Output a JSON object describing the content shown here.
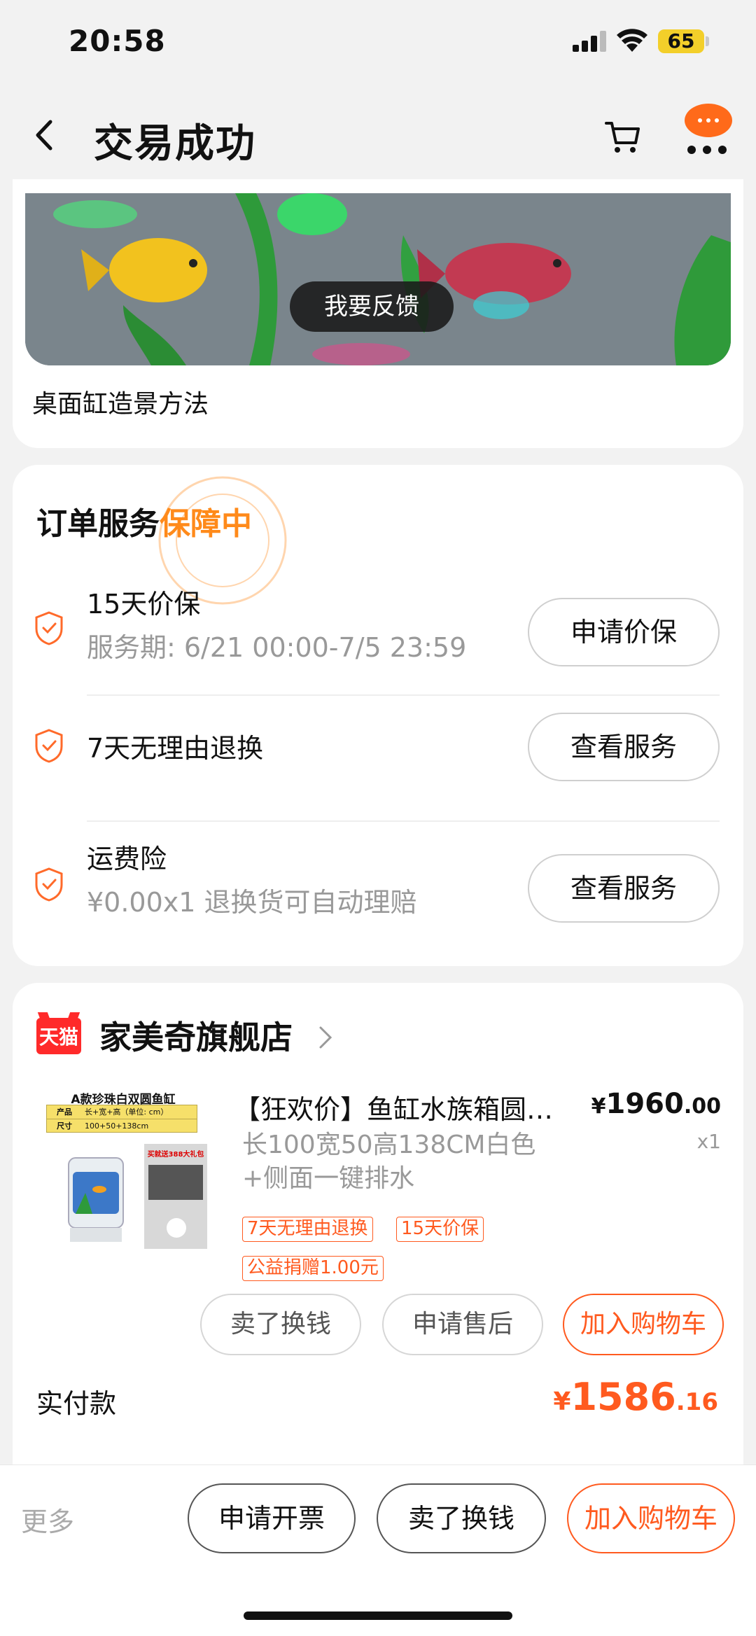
{
  "status_bar": {
    "time": "20:58",
    "battery": "65"
  },
  "nav": {
    "title": "交易成功"
  },
  "video": {
    "feedback_label": "我要反馈",
    "caption": "桌面缸造景方法"
  },
  "service": {
    "title": "订单服务",
    "status": "保障中",
    "items": [
      {
        "name": "15天价保",
        "sub": "服务期: 6/21 00:00-7/5 23:59",
        "button": "申请价保"
      },
      {
        "name": "7天无理由退换",
        "sub": "",
        "button": "查看服务"
      },
      {
        "name": "运费险",
        "sub": "¥0.00x1  退换货可自动理赔",
        "button": "查看服务"
      }
    ]
  },
  "shop": {
    "badge": "天猫",
    "name": "家美奇旗舰店",
    "product": {
      "image_title": "A款珍珠白双圆鱼缸",
      "image_table_head": [
        "产品",
        "长+宽+高（单位: cm）"
      ],
      "image_table_row": [
        "尺寸",
        "100+50+138cm"
      ],
      "image_gift": "买就送388大礼包",
      "title": "【狂欢价】鱼缸水族箱圆…",
      "price_currency": "¥",
      "price_int": "1960",
      "price_dec": ".00",
      "qty": "x1",
      "spec_line1": "长100宽50高138CM白色",
      "spec_line2": "+侧面一键排水",
      "tags": [
        "7天无理由退换",
        "15天价保"
      ],
      "donation": "公益捐赠1.00元"
    },
    "actions": [
      "卖了换钱",
      "申请售后",
      "加入购物车"
    ],
    "paid_label": "实付款",
    "paid_currency": "¥",
    "paid_int": "1586",
    "paid_dec": ".16"
  },
  "bottom_bar": {
    "more": "更多",
    "buttons": [
      "申请开票",
      "卖了换钱",
      "加入购物车"
    ]
  },
  "colors": {
    "accent": "#ff5a1f",
    "highlight": "#ff8a1a",
    "background": "#f2f2f2"
  }
}
